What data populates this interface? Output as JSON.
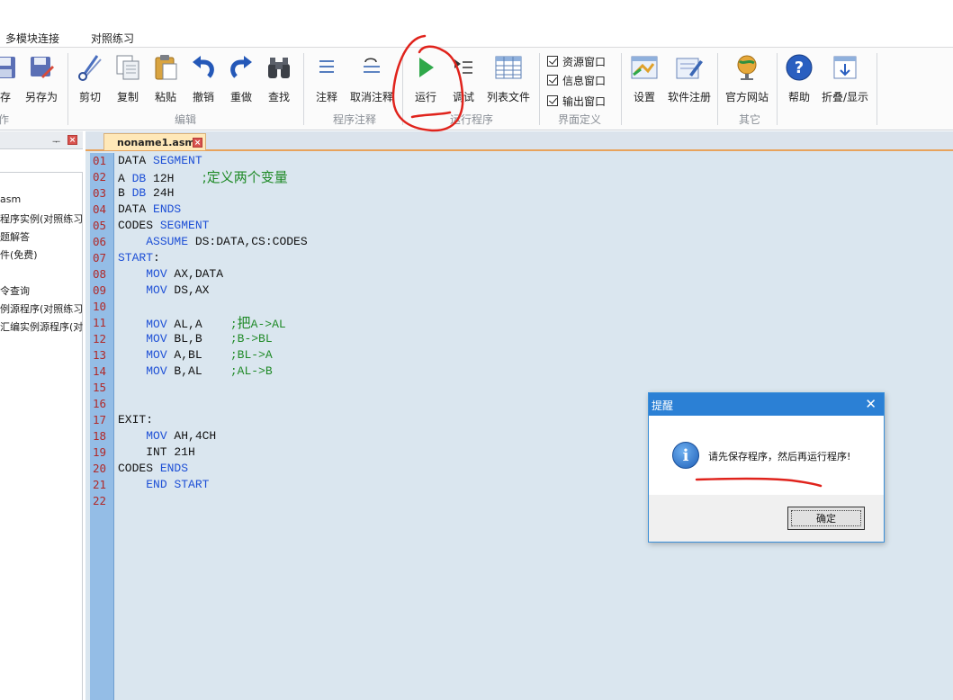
{
  "menu": {
    "tabs": [
      "多模块连接",
      "对照练习"
    ]
  },
  "ribbon": {
    "file": {
      "save_label": "保存",
      "saveas_label": "另存为",
      "group_label": "操作"
    },
    "edit": {
      "cut_label": "剪切",
      "copy_label": "复制",
      "paste_label": "粘贴",
      "undo_label": "撤销",
      "redo_label": "重做",
      "find_label": "查找",
      "group_label": "编辑"
    },
    "comment": {
      "comment_label": "注释",
      "uncomment_label": "取消注释",
      "group_label": "程序注释"
    },
    "run": {
      "run_label": "运行",
      "debug_label": "调试",
      "listfile_label": "列表文件",
      "group_label": "运行程序"
    },
    "view": {
      "resource_window": "资源窗口",
      "info_window": "信息窗口",
      "output_window": "输出窗口",
      "group_label": "界面定义"
    },
    "other": {
      "settings_label": "设置",
      "register_label": "软件注册",
      "website_label": "官方网站",
      "help_label": "帮助",
      "fold_label": "折叠/显示",
      "group_label": "其它"
    }
  },
  "left_panel": {
    "items": [
      "asm",
      "程序实例(对照练习",
      "题解答",
      "件(免费)",
      "令查询",
      "例源程序(对照练习",
      "汇编实例源程序(对"
    ]
  },
  "editor": {
    "tab_name": "noname1.asm",
    "line_numbers": [
      "01",
      "02",
      "03",
      "04",
      "05",
      "06",
      "07",
      "08",
      "09",
      "10",
      "11",
      "12",
      "13",
      "14",
      "15",
      "16",
      "17",
      "18",
      "19",
      "20",
      "21",
      "22"
    ]
  },
  "dialog": {
    "title": "提醒",
    "close": "✕",
    "message": "请先保存程序，然后再运行程序!",
    "ok_label": "确定",
    "icon_glyph": "i"
  },
  "colors": {
    "ribbon_bg": "#fbfbfb",
    "editor_bg": "#dae6ef",
    "gutter_bg": "#94bde6",
    "keyword": "#1d4fd6",
    "comment": "#1f8a27",
    "line_number": "#b02a2a",
    "dialog_title": "#2b80d5",
    "annotation_red": "#e0231c"
  }
}
